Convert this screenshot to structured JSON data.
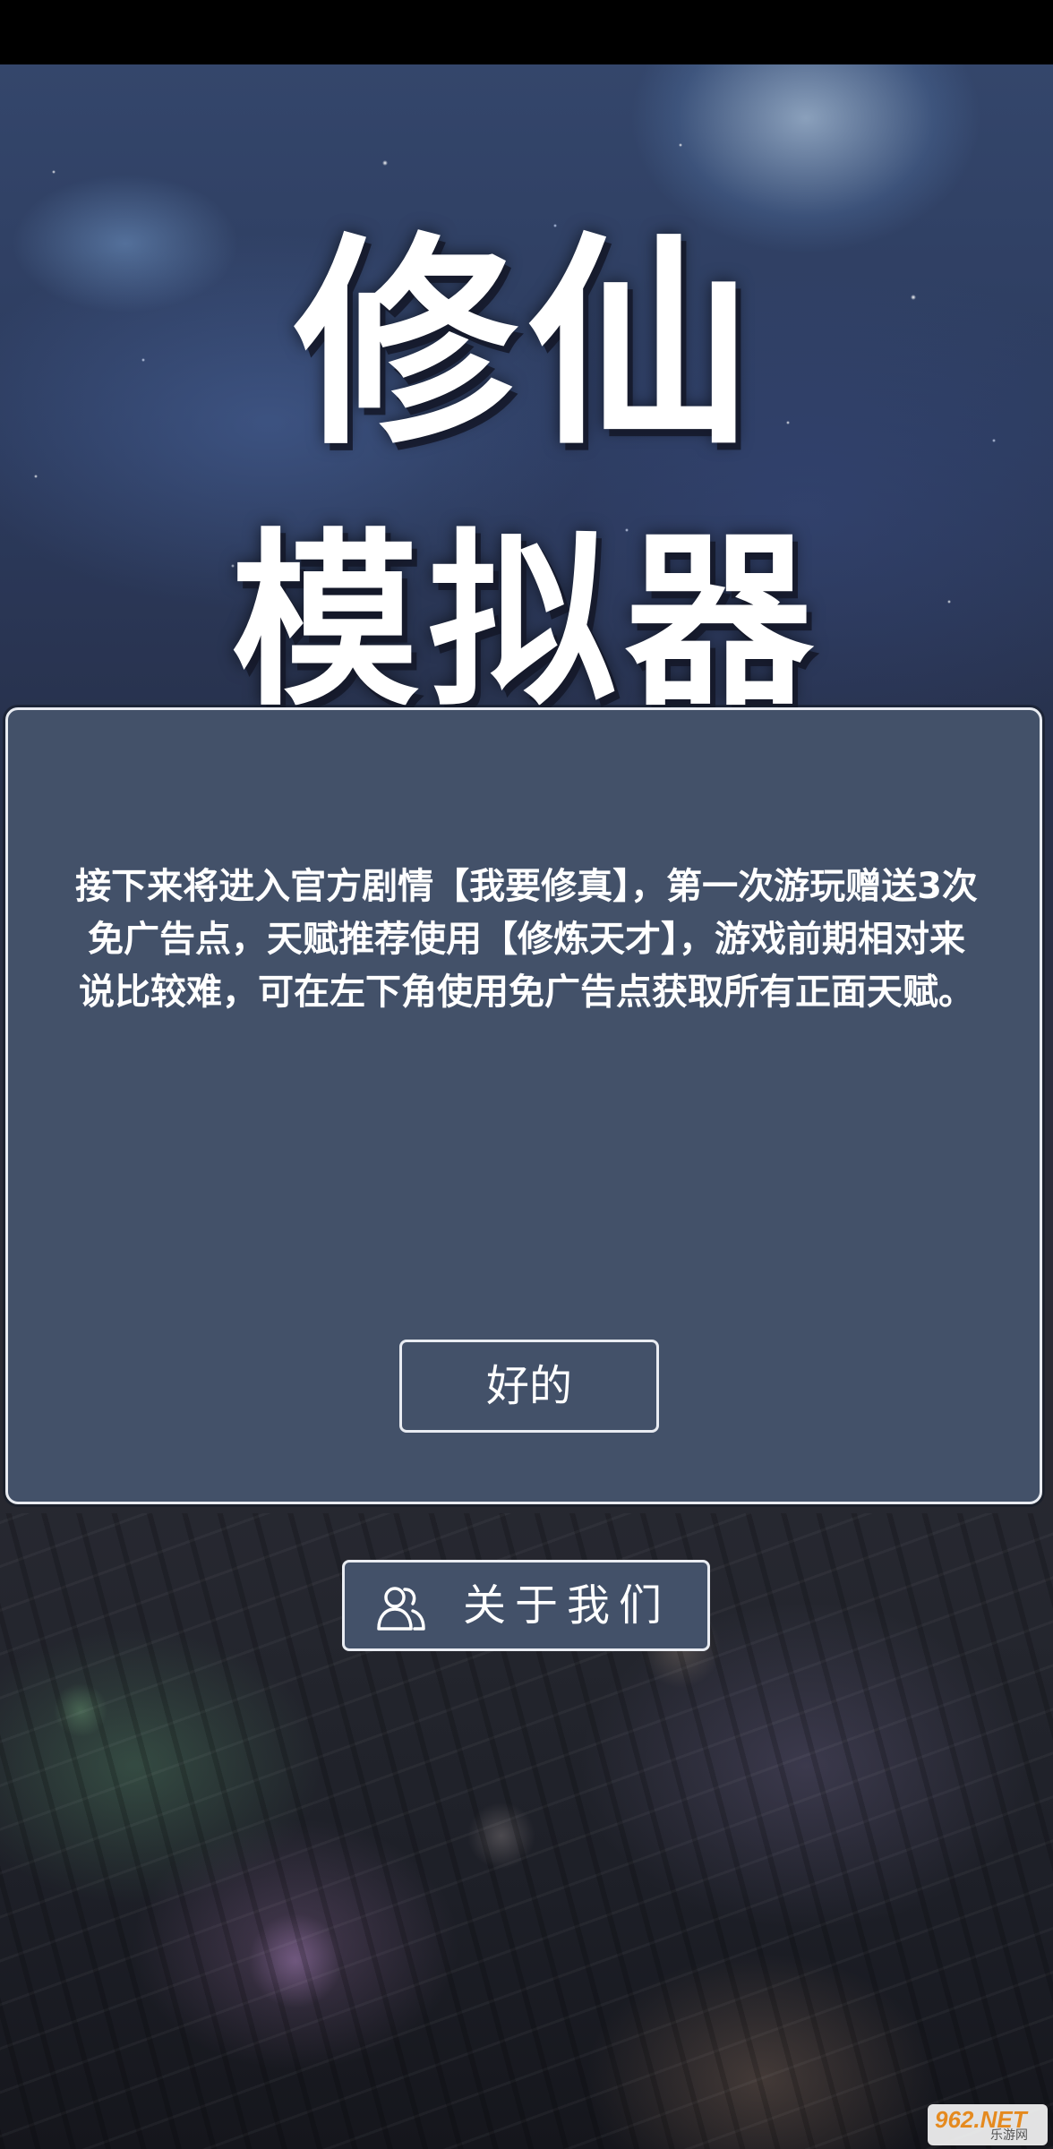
{
  "app": {
    "title_line1": "修仙",
    "title_line2": "模拟器"
  },
  "dialog": {
    "message": "接下来将进入官方剧情【我要修真】，第一次游玩赠送3次免广告点，天赋推荐使用【修炼天才】，游戏前期相对来说比较难，可在左下角使用免广告点获取所有正面天赋。",
    "ok_label": "好的"
  },
  "about": {
    "label": "关于我们",
    "icon": "users-icon"
  },
  "watermark": {
    "text": "962.NET",
    "sub": "乐游网"
  },
  "colors": {
    "dialog_bg": "#435169",
    "border": "#e9ecf2",
    "text": "#ffffff"
  }
}
